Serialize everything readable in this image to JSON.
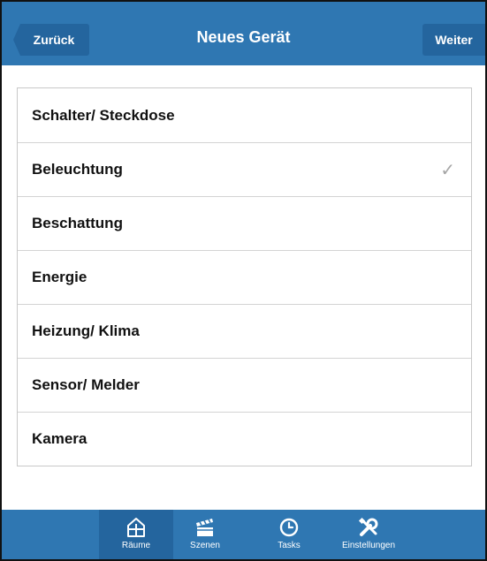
{
  "header": {
    "back_label": "Zurück",
    "title": "Neues Gerät",
    "next_label": "Weiter"
  },
  "list": {
    "items": [
      {
        "label": "Schalter/ Steckdose",
        "selected": false
      },
      {
        "label": "Beleuchtung",
        "selected": true
      },
      {
        "label": "Beschattung",
        "selected": false
      },
      {
        "label": "Energie",
        "selected": false
      },
      {
        "label": "Heizung/ Klima",
        "selected": false
      },
      {
        "label": "Sensor/ Melder",
        "selected": false
      },
      {
        "label": "Kamera",
        "selected": false
      }
    ],
    "check_glyph": "✓"
  },
  "tabbar": {
    "tabs": [
      {
        "label": "Räume",
        "icon": "house-icon",
        "active": true
      },
      {
        "label": "Szenen",
        "icon": "clapperboard-icon",
        "active": false
      },
      {
        "label": "Tasks",
        "icon": "clock-icon",
        "active": false
      },
      {
        "label": "Einstellungen",
        "icon": "tools-icon",
        "active": false
      }
    ]
  },
  "colors": {
    "brand_blue": "#2f77b2",
    "brand_blue_dark": "#24659e",
    "check_gray": "#a6a6a6"
  }
}
